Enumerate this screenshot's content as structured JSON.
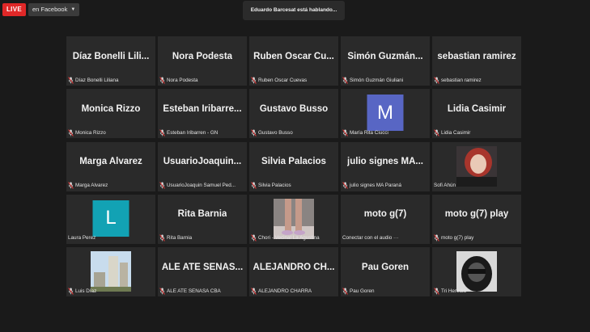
{
  "live": {
    "badge": "LIVE",
    "destination": "en Facebook"
  },
  "speaking_banner": "Eduardo Barcesat está hablando...",
  "colors": {
    "live_red": "#e02828",
    "tile_bg": "#2a2a2a",
    "avatar_m": "#5866c4",
    "avatar_l": "#12a2b4"
  },
  "tiles": [
    {
      "big": "Díaz Bonelli Lili...",
      "footer": "Díaz Bonelli Liliana",
      "muted": true
    },
    {
      "big": "Nora Podesta",
      "footer": "Nora Podesta",
      "muted": true
    },
    {
      "big": "Ruben Oscar Cu...",
      "footer": "Ruben Oscar Cuevas",
      "muted": true
    },
    {
      "big": "Simón Guzmán...",
      "footer": "Simón Guzmán Giuliani",
      "muted": true
    },
    {
      "big": "sebastian ramirez",
      "footer": "sebastian ramirez",
      "muted": true
    },
    {
      "big": "Monica Rizzo",
      "footer": "Monica Rizzo",
      "muted": true
    },
    {
      "big": "Esteban Iribarre...",
      "footer": "Esteban Iribarren - GN",
      "muted": true
    },
    {
      "big": "Gustavo Busso",
      "footer": "Gustavo Busso",
      "muted": true
    },
    {
      "avatar": "M",
      "footer": "María Rita Ciucci",
      "muted": true
    },
    {
      "big": "Lidia Casimir",
      "footer": "Lidia Casimir",
      "muted": true
    },
    {
      "big": "Marga Alvarez",
      "footer": "Marga Alvarez",
      "muted": true
    },
    {
      "big": "UsuarioJoaquin...",
      "footer": "UsuarioJoaquin Samuel Ped...",
      "muted": true
    },
    {
      "big": "Silvia Palacios",
      "footer": "Silvia Palacios",
      "muted": true
    },
    {
      "big": "julio signes MA...",
      "footer": "julio signes MA Paraná",
      "muted": true
    },
    {
      "photo": "portrait-red-hair",
      "footer": "Sofi Ahún",
      "muted": false
    },
    {
      "avatar": "L",
      "footer": "Laura Perez",
      "muted": false
    },
    {
      "big": "Rita Barnia",
      "footer": "Rita Barnia",
      "muted": true
    },
    {
      "photo": "legs-floor",
      "footer": "Chori - Vecinal La Agustina",
      "muted": true
    },
    {
      "big": "moto g(7)",
      "footer": "Conectar con el audio ···",
      "muted": false
    },
    {
      "big": "moto g(7) play",
      "footer": "moto g(7) play",
      "muted": true
    },
    {
      "photo": "buildings-sky",
      "footer": "Luis Díaz",
      "muted": true
    },
    {
      "big": "ALE ATE SENAS...",
      "footer": "ALE ATE SENASA CBA",
      "muted": true
    },
    {
      "big": "ALEJANDRO CH...",
      "footer": "ALEJANDRO CHARRA",
      "muted": true
    },
    {
      "big": "Pau Goren",
      "footer": "Pau Goren",
      "muted": true
    },
    {
      "photo": "hooded-person",
      "footer": "Tri Heredia",
      "muted": true
    }
  ]
}
